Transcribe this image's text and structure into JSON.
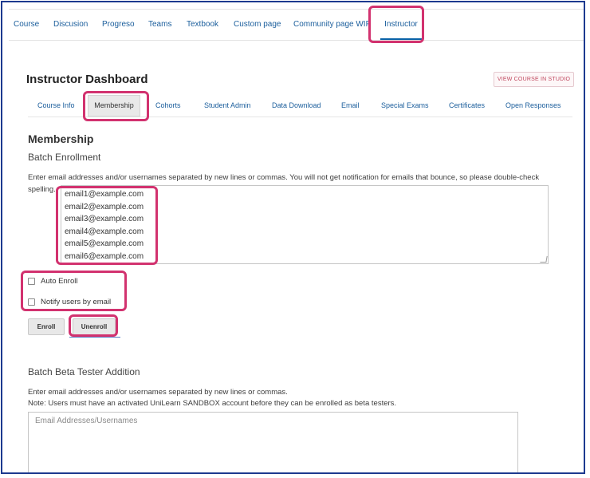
{
  "course_nav": {
    "tabs": [
      {
        "label": "Course"
      },
      {
        "label": "Discusion"
      },
      {
        "label": "Progreso"
      },
      {
        "label": "Teams"
      },
      {
        "label": "Textbook"
      },
      {
        "label": "Custom page"
      },
      {
        "label": "Community page WIP"
      },
      {
        "label": "Instructor",
        "active": true
      }
    ]
  },
  "dashboard": {
    "title": "Instructor Dashboard",
    "studio_button": "VIEW COURSE IN STUDIO",
    "tabs": [
      {
        "label": "Course Info"
      },
      {
        "label": "Membership",
        "active": true
      },
      {
        "label": "Cohorts"
      },
      {
        "label": "Student Admin"
      },
      {
        "label": "Data Download"
      },
      {
        "label": "Email"
      },
      {
        "label": "Special Exams"
      },
      {
        "label": "Certificates"
      },
      {
        "label": "Open Responses"
      }
    ]
  },
  "membership": {
    "heading": "Membership",
    "batch_enrollment": {
      "heading": "Batch Enrollment",
      "instructions_line1": "Enter email addresses and/or usernames separated by new lines or commas. You will not get notification for emails that bounce, so please double-check",
      "instructions_line2": "spelling.",
      "emails": [
        "email1@example.com",
        "email2@example.com",
        "email3@example.com",
        "email4@example.com",
        "email5@example.com",
        "email6@example.com"
      ],
      "auto_enroll_label": "Auto Enroll",
      "notify_label": "Notify users by email",
      "enroll_button": "Enroll",
      "unenroll_button": "Unenroll"
    },
    "batch_beta": {
      "heading": "Batch Beta Tester Addition",
      "instructions": "Enter email addresses and/or usernames separated by new lines or commas.",
      "note": "Note: Users must have an activated UniLearn SANDBOX account before they can be enrolled as beta testers.",
      "placeholder": "Email Addresses/Usernames"
    }
  },
  "colors": {
    "link": "#1b5e9c",
    "highlight": "#d2326f",
    "frame": "#1d3a8f"
  }
}
